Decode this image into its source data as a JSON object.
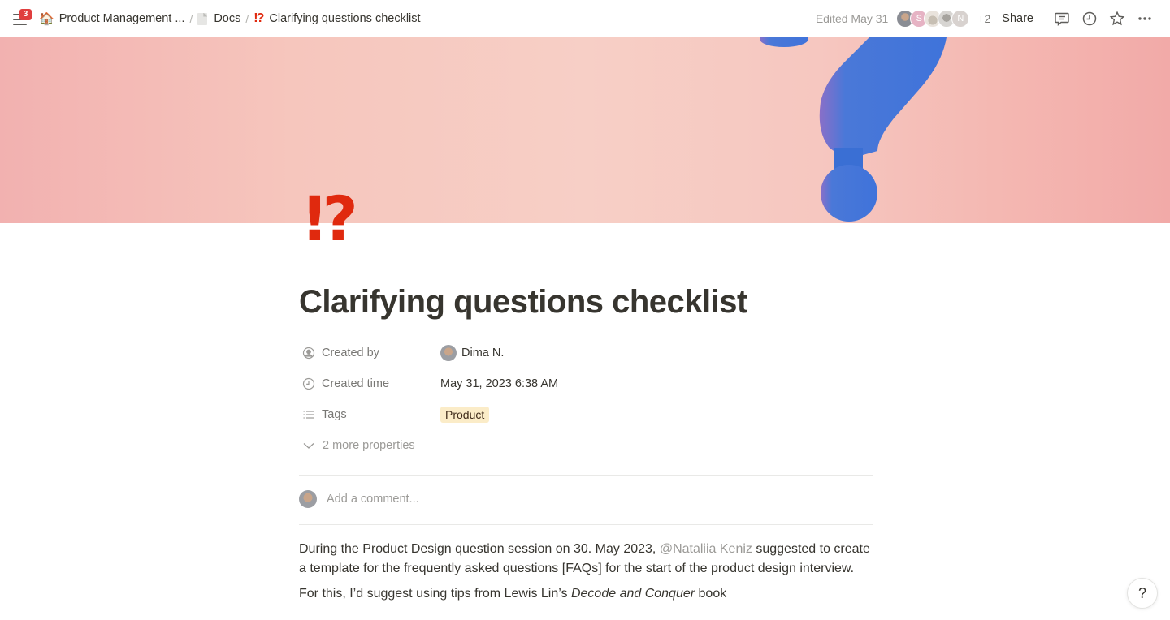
{
  "topbar": {
    "notification_count": "3",
    "breadcrumb": [
      {
        "icon": "house-icon",
        "glyph": "🏠",
        "label": "Product Management ..."
      },
      {
        "icon": "document-icon",
        "label": "Docs"
      },
      {
        "icon": "interrobang-icon",
        "glyph": "⁉",
        "label": "Clarifying questions checklist"
      }
    ],
    "separator": "/",
    "edited": "Edited May 31",
    "avatars": [
      {
        "type": "photo",
        "initial": ""
      },
      {
        "type": "initial",
        "initial": "S"
      },
      {
        "type": "cartoon",
        "initial": ""
      },
      {
        "type": "photo",
        "initial": ""
      },
      {
        "type": "initial",
        "initial": "N"
      }
    ],
    "extra_people": "+2",
    "share_label": "Share",
    "icons": [
      "comment-icon",
      "history-clock-icon",
      "star-icon",
      "more-options-icon"
    ]
  },
  "page": {
    "icon_glyph": "⁉",
    "title": "Clarifying questions checklist",
    "properties": [
      {
        "icon": "person-circle-icon",
        "name": "Created by",
        "value": "Dima N."
      },
      {
        "icon": "clock-icon",
        "name": "Created time",
        "value": "May 31, 2023 6:38 AM"
      },
      {
        "icon": "list-icon",
        "name": "Tags",
        "value": "Product"
      }
    ],
    "more_properties": "2 more properties",
    "comment_placeholder": "Add a comment...",
    "body": {
      "p1_before": "During the Product Design question session on 30. May 2023, ",
      "p1_mention": "@Nataliia Keniz",
      "p1_after": " suggested to create a template for the frequently asked questions [FAQs] for the start of the product design interview.",
      "p2_before": "For this, I’d suggest using tips from Lewis Lin’s ",
      "p2_italic": "Decode and Conquer",
      "p2_after": " book"
    }
  },
  "help_label": "?",
  "colors": {
    "accent_red": "#e0290e",
    "tag_bg": "#fbecc8",
    "badge_red": "#e03e3e",
    "cover_pink": "#f6c6bd",
    "cover_blue": "#3d6fd6"
  }
}
